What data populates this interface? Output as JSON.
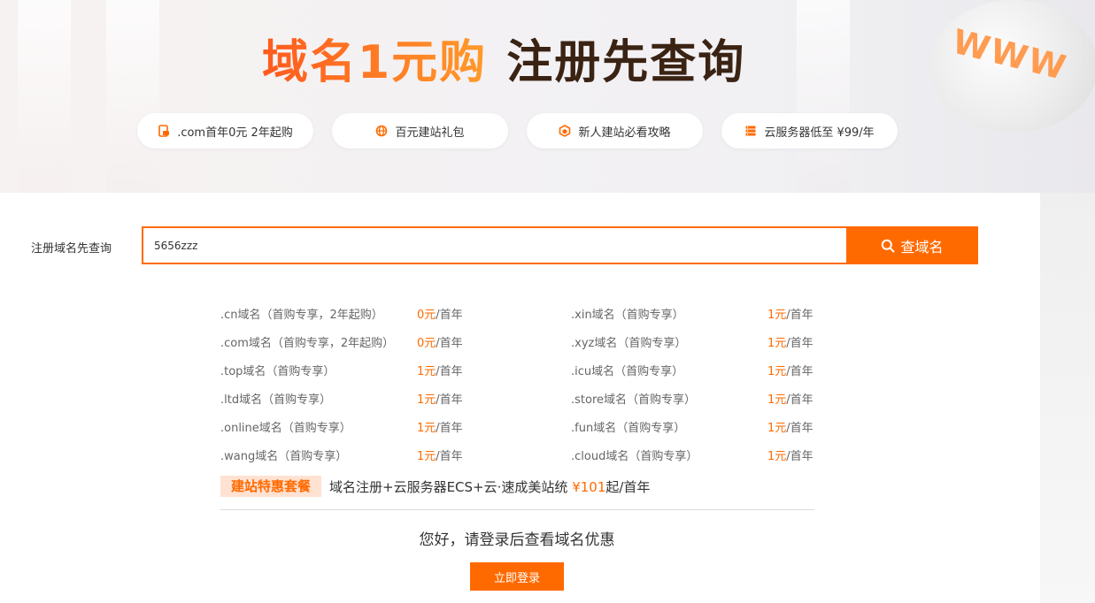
{
  "hero": {
    "title_orange": "域名1元购",
    "title_dark": "注册先查询",
    "globe_text": "WWW",
    "pills": [
      {
        "icon": "domain-icon",
        "label": ".com首年0元 2年起购"
      },
      {
        "icon": "globe-icon",
        "label": "百元建站礼包"
      },
      {
        "icon": "cube-icon",
        "label": "新人建站必看攻略"
      },
      {
        "icon": "server-icon",
        "label": "云服务器低至 ¥99/年"
      }
    ]
  },
  "search": {
    "label": "注册域名先查询",
    "value": "5656zzz",
    "button_label": "查域名"
  },
  "domains": [
    {
      "name": ".cn域名（首购专享，2年起购）",
      "price": "0元",
      "unit": "/首年"
    },
    {
      "name": ".xin域名（首购专享）",
      "price": "1元",
      "unit": "/首年"
    },
    {
      "name": ".com域名（首购专享，2年起购）",
      "price": "0元",
      "unit": "/首年"
    },
    {
      "name": ".xyz域名（首购专享）",
      "price": "1元",
      "unit": "/首年"
    },
    {
      "name": ".top域名（首购专享）",
      "price": "1元",
      "unit": "/首年"
    },
    {
      "name": ".icu域名（首购专享）",
      "price": "1元",
      "unit": "/首年"
    },
    {
      "name": ".ltd域名（首购专享）",
      "price": "1元",
      "unit": "/首年"
    },
    {
      "name": ".store域名（首购专享）",
      "price": "1元",
      "unit": "/首年"
    },
    {
      "name": ".online域名（首购专享）",
      "price": "1元",
      "unit": "/首年"
    },
    {
      "name": ".fun域名（首购专享）",
      "price": "1元",
      "unit": "/首年"
    },
    {
      "name": ".wang域名（首购专享）",
      "price": "1元",
      "unit": "/首年"
    },
    {
      "name": ".cloud域名（首购专享）",
      "price": "1元",
      "unit": "/首年"
    }
  ],
  "promo": {
    "tag": "建站特惠套餐",
    "text": "域名注册+云服务器ECS+云·速成美站统",
    "price": "¥101",
    "suffix": "起/首年"
  },
  "login": {
    "hint": "您好，请登录后查看域名优惠",
    "button_label": "立即登录"
  },
  "colors": {
    "accent": "#ff6a00",
    "tag_bg": "#ffe2d2"
  }
}
